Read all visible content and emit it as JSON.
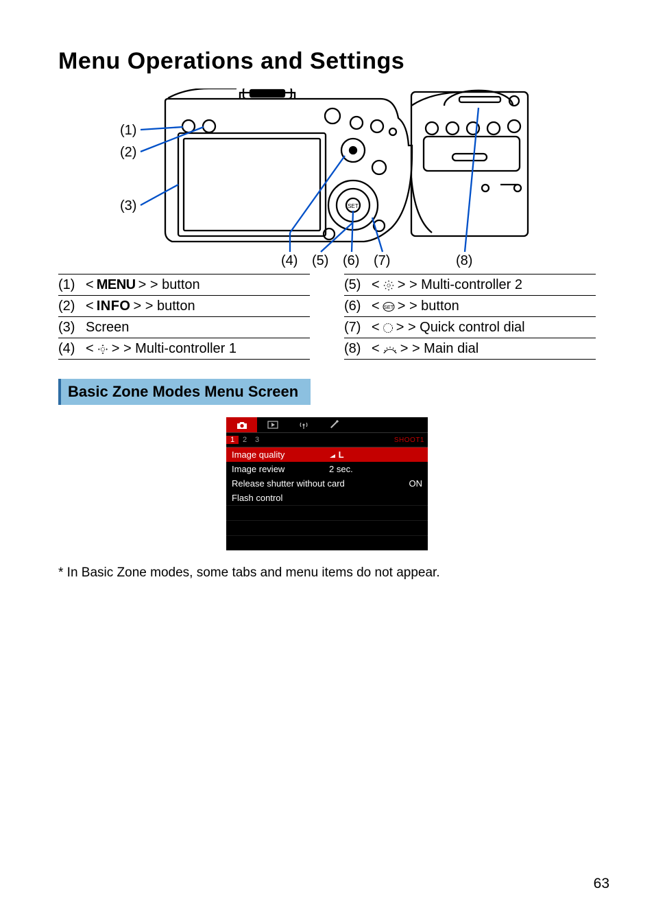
{
  "page_title": "Menu Operations and Settings",
  "diagram": {
    "callouts_left": [
      "(1)",
      "(2)",
      "(3)"
    ],
    "callouts_bottom": [
      "(4)",
      "(5)",
      "(6)",
      "(7)",
      "(8)"
    ]
  },
  "legend": {
    "left": [
      {
        "num": "(1)",
        "prefix": "<",
        "glyph": "MENU",
        "suffix": "> button"
      },
      {
        "num": "(2)",
        "prefix": "<",
        "glyph": "INFO",
        "suffix": "> button"
      },
      {
        "num": "(3)",
        "prefix": "",
        "glyph": "",
        "suffix": "Screen"
      },
      {
        "num": "(4)",
        "prefix": "<",
        "glyph": "multi1",
        "suffix": "> Multi-controller 1"
      }
    ],
    "right": [
      {
        "num": "(5)",
        "prefix": "<",
        "glyph": "multi2",
        "suffix": "> Multi-controller 2"
      },
      {
        "num": "(6)",
        "prefix": "<",
        "glyph": "set",
        "suffix": "> button"
      },
      {
        "num": "(7)",
        "prefix": "<",
        "glyph": "qdial",
        "suffix": "> Quick control dial"
      },
      {
        "num": "(8)",
        "prefix": "<",
        "glyph": "mdial",
        "suffix": "> Main dial"
      }
    ]
  },
  "section_header": "Basic Zone Modes Menu Screen",
  "lcd": {
    "subtabs": [
      "1",
      "2",
      "3"
    ],
    "sublabel": "SHOOT1",
    "items": [
      {
        "label": "Image quality",
        "value": "◢L",
        "selected": true,
        "value_pos": "center"
      },
      {
        "label": "Image review",
        "value": "2 sec.",
        "value_pos": "center"
      },
      {
        "label": "Release shutter without card",
        "value": "ON",
        "value_pos": "right"
      },
      {
        "label": "Flash control",
        "value": ""
      }
    ]
  },
  "footnote": "* In Basic Zone modes, some tabs and menu items do not appear.",
  "page_number": "63"
}
